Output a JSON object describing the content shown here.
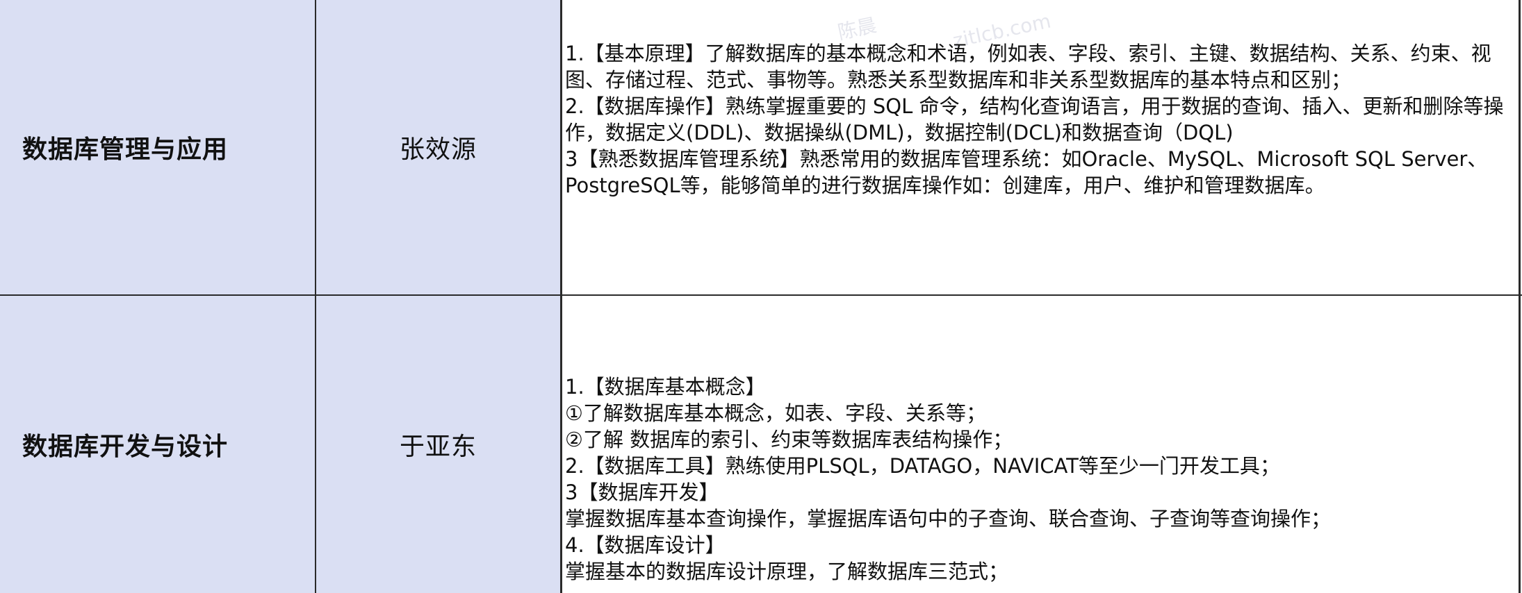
{
  "rows": [
    {
      "module": "数据库管理与应用",
      "owner": "张效源",
      "description": [
        "1.【基本原理】了解数据库的基本概念和术语，例如表、字段、索引、主键、数据结构、关系、约束、视图、存储过程、范式、事物等。熟悉关系型数据库和非关系型数据库的基本特点和区别；",
        "2.【数据库操作】熟练掌握重要的 SQL 命令，结构化查询语言，用于数据的查询、插入、更新和删除等操作，数据定义(DDL)、数据操纵(DML)，数据控制(DCL)和数据查询（DQL)",
        "3【熟悉数据库管理系统】熟悉常用的数据库管理系统：如Oracle、MySQL、Microsoft SQL Server、PostgreSQL等，能够简单的进行数据库操作如：创建库，用户、维护和管理数据库。"
      ]
    },
    {
      "module": "数据库开发与设计",
      "owner": "于亚东",
      "description": [
        "1.【数据库基本概念】",
        "①了解数据库基本概念，如表、字段、关系等；",
        "②了解 数据库的索引、约束等数据库表结构操作；",
        "2.【数据库工具】熟练使用PLSQL，DATAGO，NAVICAT等至少一门开发工具；",
        "3【数据库开发】",
        "掌握数据库基本查询操作，掌握据库语句中的子查询、联合查询、子查询等查询操作；",
        "4.【数据库设计】",
        "掌握基本的数据库设计原理，了解数据库三范式；"
      ]
    }
  ],
  "watermark": {
    "name": "陈晨",
    "email": "zitlcb.com"
  },
  "colors": {
    "shade": "#dadff3",
    "grid": "#2a2a2a",
    "text": "#111111"
  }
}
